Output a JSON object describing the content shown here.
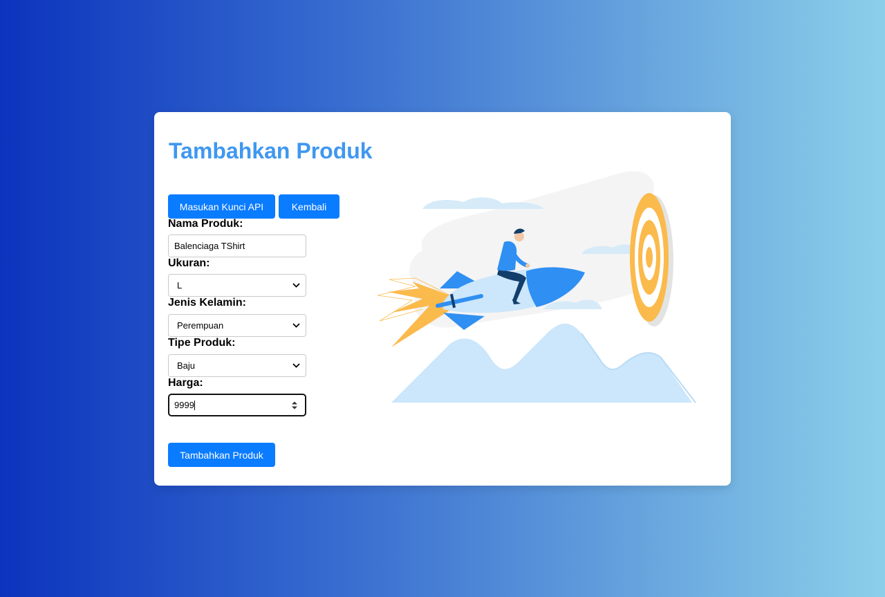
{
  "form": {
    "title": "Tambahkan Produk",
    "api_key_button": "Masukan Kunci API",
    "back_button": "Kembali",
    "fields": {
      "nama_produk": {
        "label": "Nama Produk:",
        "value": "Balenciaga TShirt"
      },
      "ukuran": {
        "label": "Ukuran:",
        "value": "L"
      },
      "jenis_kelamin": {
        "label": "Jenis Kelamin:",
        "value": "Perempuan"
      },
      "tipe_produk": {
        "label": "Tipe Produk:",
        "value": "Baju"
      },
      "harga": {
        "label": "Harga:",
        "value": "9999"
      }
    },
    "submit_button": "Tambahkan Produk"
  },
  "colors": {
    "accent": "#0a7cff",
    "title": "#3f97f0",
    "background_start": "#0b33bd",
    "background_end": "#8bcfea"
  },
  "illustration": {
    "icon": "rocket-launch-illustration"
  }
}
